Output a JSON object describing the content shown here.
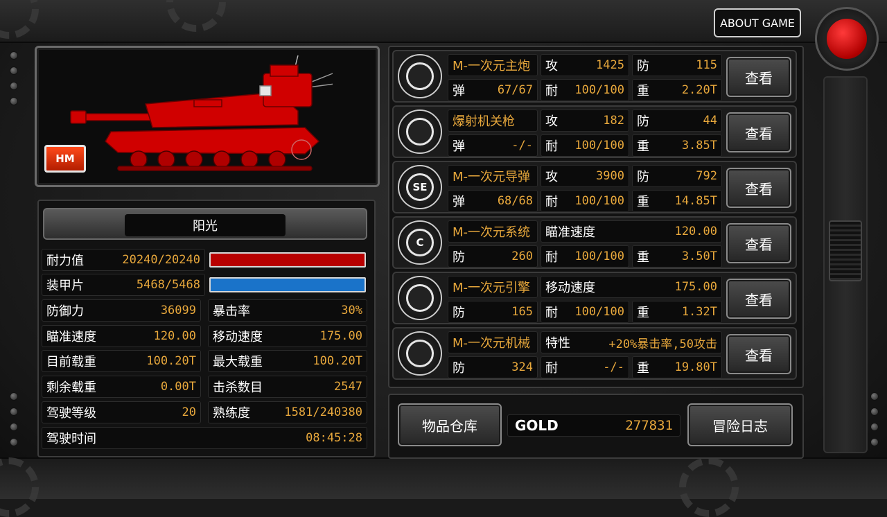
{
  "header": {
    "about_label": "ABOUT GAME"
  },
  "tank": {
    "badge": "HM",
    "name": "阳光",
    "color": "#cc0000"
  },
  "stats": {
    "durability": {
      "label": "耐力值",
      "value": "20240/20240",
      "fill": 1.0,
      "color": "#b80000"
    },
    "armor": {
      "label": "装甲片",
      "value": "5468/5468",
      "fill": 1.0,
      "color": "#1a73c9"
    },
    "grid": [
      {
        "left": {
          "label": "防御力",
          "value": "36099"
        },
        "right": {
          "label": "暴击率",
          "value": "30%"
        }
      },
      {
        "left": {
          "label": "瞄准速度",
          "value": "120.00"
        },
        "right": {
          "label": "移动速度",
          "value": "175.00"
        }
      },
      {
        "left": {
          "label": "目前载重",
          "value": "100.20T"
        },
        "right": {
          "label": "最大载重",
          "value": "100.20T"
        }
      },
      {
        "left": {
          "label": "剩余载重",
          "value": "0.00T"
        },
        "right": {
          "label": "击杀数目",
          "value": "2547"
        }
      },
      {
        "left": {
          "label": "驾驶等级",
          "value": "20"
        },
        "right": {
          "label": "熟练度",
          "value": "1581/240380"
        }
      }
    ],
    "drive_time": {
      "label": "驾驶时间",
      "value": "08:45:28"
    }
  },
  "equipment": [
    {
      "icon": "cannon-icon",
      "name": "M-一次元主炮",
      "c2": {
        "label": "攻",
        "value": "1425"
      },
      "c3": {
        "label": "防",
        "value": "115"
      },
      "c4": {
        "label": "弹",
        "value": "67/67"
      },
      "c5": {
        "label": "耐",
        "value": "100/100"
      },
      "c6": {
        "label": "重",
        "value": "2.20T"
      },
      "button": "查看"
    },
    {
      "icon": "machine-gun-icon",
      "name": "爆射机关枪",
      "c2": {
        "label": "攻",
        "value": "182"
      },
      "c3": {
        "label": "防",
        "value": "44"
      },
      "c4": {
        "label": "弹",
        "value": "-/-"
      },
      "c5": {
        "label": "耐",
        "value": "100/100"
      },
      "c6": {
        "label": "重",
        "value": "3.85T"
      },
      "button": "查看"
    },
    {
      "icon": "missile-icon",
      "icon_text": "SE",
      "name": "M-一次元导弹",
      "c2": {
        "label": "攻",
        "value": "3900"
      },
      "c3": {
        "label": "防",
        "value": "792"
      },
      "c4": {
        "label": "弹",
        "value": "68/68"
      },
      "c5": {
        "label": "耐",
        "value": "100/100"
      },
      "c6": {
        "label": "重",
        "value": "14.85T"
      },
      "button": "查看"
    },
    {
      "icon": "system-icon",
      "icon_text": "C",
      "name": "M-一次元系统",
      "wide": {
        "label": "瞄准速度",
        "value": "120.00"
      },
      "c4": {
        "label": "防",
        "value": "260"
      },
      "c5": {
        "label": "耐",
        "value": "100/100"
      },
      "c6": {
        "label": "重",
        "value": "3.50T"
      },
      "button": "查看"
    },
    {
      "icon": "engine-icon",
      "name": "M-一次元引擎",
      "wide": {
        "label": "移动速度",
        "value": "175.00"
      },
      "c4": {
        "label": "防",
        "value": "165"
      },
      "c5": {
        "label": "耐",
        "value": "100/100"
      },
      "c6": {
        "label": "重",
        "value": "1.32T"
      },
      "button": "查看"
    },
    {
      "icon": "chassis-icon",
      "name": "M-一次元机械",
      "wide": {
        "label": "特性",
        "value": "+20%暴击率,50攻击"
      },
      "c4": {
        "label": "防",
        "value": "324"
      },
      "c5": {
        "label": "耐",
        "value": "-/-"
      },
      "c6": {
        "label": "重",
        "value": "19.80T"
      },
      "button": "查看"
    }
  ],
  "footer": {
    "warehouse_label": "物品仓库",
    "gold_label": "GOLD",
    "gold_value": "277831",
    "log_label": "冒险日志"
  }
}
